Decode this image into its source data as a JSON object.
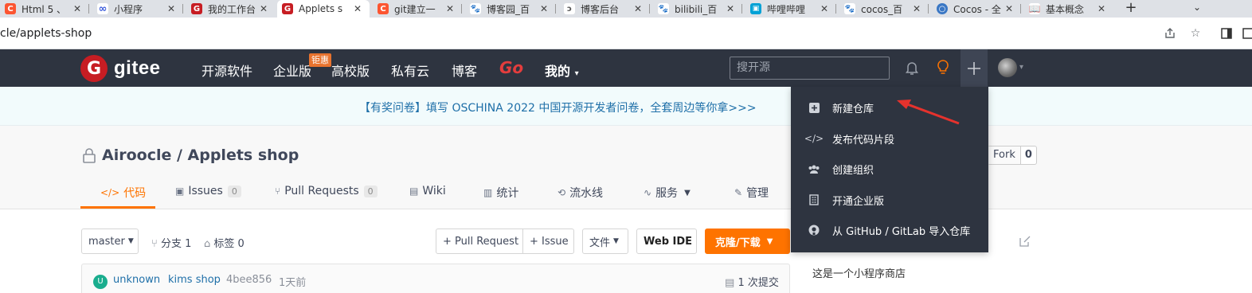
{
  "browser": {
    "tabs": [
      {
        "title": "Html 5 、",
        "icon": "csdn-icon",
        "color": "#fc5531"
      },
      {
        "title": "小程序",
        "icon": "link-icon",
        "color": "#3b5bdb"
      },
      {
        "title": "我的工作台",
        "icon": "gitee-icon",
        "color": "#c71d23"
      },
      {
        "title": "Applets s",
        "icon": "gitee-icon",
        "color": "#c71d23"
      },
      {
        "title": "git建立一",
        "icon": "csdn-icon",
        "color": "#fc5531"
      },
      {
        "title": "博客园_百",
        "icon": "baidu-icon",
        "color": "#2932e1"
      },
      {
        "title": "博客后台",
        "icon": "cnblogs-icon",
        "color": "#555555"
      },
      {
        "title": "bilibili_百",
        "icon": "baidu-icon",
        "color": "#2932e1"
      },
      {
        "title": "哔哩哔哩",
        "icon": "bilibili-icon",
        "color": "#00a1d6"
      },
      {
        "title": "cocos_百",
        "icon": "baidu-icon",
        "color": "#2932e1"
      },
      {
        "title": "Cocos - 全",
        "icon": "cocos-icon",
        "color": "#3a77c4"
      },
      {
        "title": "基本概念",
        "icon": "book-icon",
        "color": "#444444"
      }
    ],
    "new_tab": "+",
    "url": "cle/applets-shop"
  },
  "nav": {
    "logo_word": "gitee",
    "links": [
      "开源软件",
      "企业版",
      "高校版",
      "私有云",
      "博客"
    ],
    "promo_badge": "钜惠",
    "go": "Go",
    "mine": "我的",
    "search_placeholder": "搜开源"
  },
  "announcement": "【有奖问卷】填写 OSCHINA 2022 中国开源开发者问卷，全套周边等你拿>>>",
  "repo": {
    "title": "Airoocle / Applets shop",
    "fork_label": "Fork",
    "fork_count": "0",
    "tabs": [
      {
        "label": "代码",
        "icon": "</>",
        "badge": ""
      },
      {
        "label": "Issues",
        "icon": "▣",
        "badge": "0"
      },
      {
        "label": "Pull Requests",
        "icon": "⑂",
        "badge": "0"
      },
      {
        "label": "Wiki",
        "icon": "▤",
        "badge": ""
      },
      {
        "label": "统计",
        "icon": "▥",
        "badge": ""
      },
      {
        "label": "流水线",
        "icon": "⟲",
        "badge": ""
      },
      {
        "label": "服务",
        "icon": "∿",
        "badge": ""
      },
      {
        "label": "管理",
        "icon": "✎",
        "badge": ""
      }
    ]
  },
  "toolbar": {
    "branch": "master",
    "branches": "分支 1",
    "tags": "标签 0",
    "pull_request": "+ Pull Request",
    "issue": "+ Issue",
    "file": "文件",
    "web_ide": "Web IDE",
    "clone": "克隆/下载"
  },
  "commit": {
    "avatar_letter": "U",
    "author": "unknown",
    "message": "kims shop",
    "hash": "4bee856",
    "time": "1天前",
    "count": "1 次提交"
  },
  "sidebar": {
    "description": "这是一个小程序商店"
  },
  "dropdown": {
    "items": [
      {
        "label": "新建仓库",
        "icon": "plus-square-icon"
      },
      {
        "label": "发布代码片段",
        "icon": "code-icon"
      },
      {
        "label": "创建组织",
        "icon": "group-icon"
      },
      {
        "label": "开通企业版",
        "icon": "building-icon"
      },
      {
        "label": "从 GitHub / GitLab 导入仓库",
        "icon": "github-icon"
      }
    ]
  },
  "colors": {
    "nav_bg": "#2e3440",
    "accent_orange": "#fe7300",
    "gitee_red": "#c71d23",
    "annotation_arrow": "#e5322d"
  }
}
